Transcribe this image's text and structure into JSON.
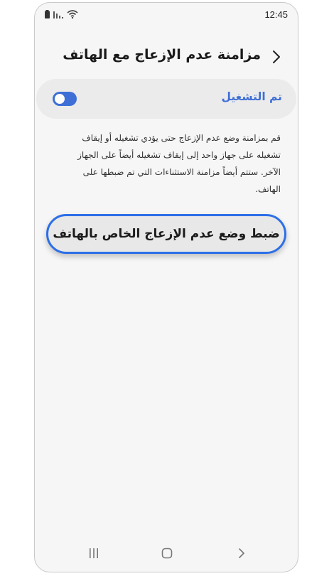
{
  "status_bar": {
    "time": "12:45",
    "icons": [
      "battery-icon",
      "signal-icon",
      "wifi-icon"
    ]
  },
  "header": {
    "title": "مزامنة عدم الإزعاج مع الهاتف",
    "back_icon": "chevron-right-icon"
  },
  "toggle": {
    "label": "تم التشغيل",
    "state": "on"
  },
  "description": "قم بمزامنة وضع عدم الإزعاج حتى يؤدي تشغيله أو إيقاف تشغيله على جهاز واحد إلى إيقاف تشغيله أيضاً على الجهاز الآخر. ستتم أيضاً مزامنة الاستثناءات التي تم ضبطها على الهاتف.",
  "action_button": {
    "label": "ضبط وضع عدم الإزعاج الخاص بالهاتف"
  },
  "nav_bar": {
    "icons": [
      "recents-icon",
      "home-icon",
      "back-icon"
    ]
  },
  "colors": {
    "accent": "#3e6fd6",
    "highlight_border": "#2c6fe8",
    "screen_background": "#f6f6f6",
    "card_background": "#ebebeb"
  }
}
